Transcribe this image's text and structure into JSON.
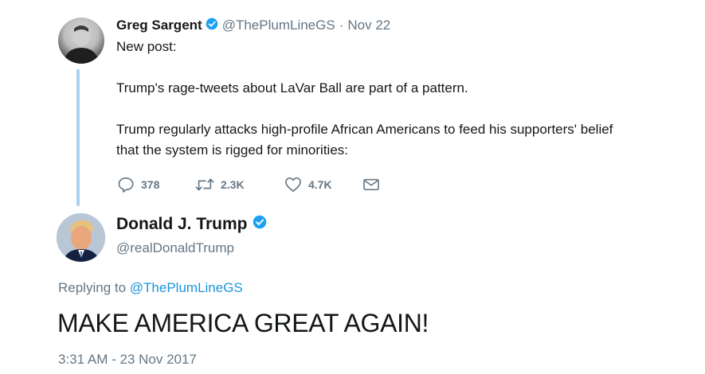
{
  "reply_to_tweet": {
    "author_name": "Greg Sargent",
    "handle": "@ThePlumLineGS",
    "separator": "·",
    "date": "Nov 22",
    "verified_icon": "verified-badge-icon",
    "text_lines": [
      "New post:",
      "Trump's rage-tweets about LaVar Ball are part of a pattern.",
      "Trump regularly attacks high-profile African Americans to feed his supporters' belief that the system is rigged for minorities:"
    ],
    "actions": {
      "reply_count": "378",
      "retweet_count": "2.3K",
      "like_count": "4.7K"
    }
  },
  "main_tweet": {
    "author_name": "Donald J. Trump",
    "handle": "@realDonaldTrump",
    "verified_icon": "verified-badge-icon",
    "replying_prefix": "Replying to",
    "replying_to": "@ThePlumLineGS",
    "text": "MAKE AMERICA GREAT AGAIN!",
    "timestamp": "3:31 AM - 23 Nov 2017"
  },
  "colors": {
    "link": "#1b95e0",
    "muted": "#657786",
    "thread_line": "#a9d1ee",
    "verified": "#1da1f2",
    "text": "#14171a"
  }
}
